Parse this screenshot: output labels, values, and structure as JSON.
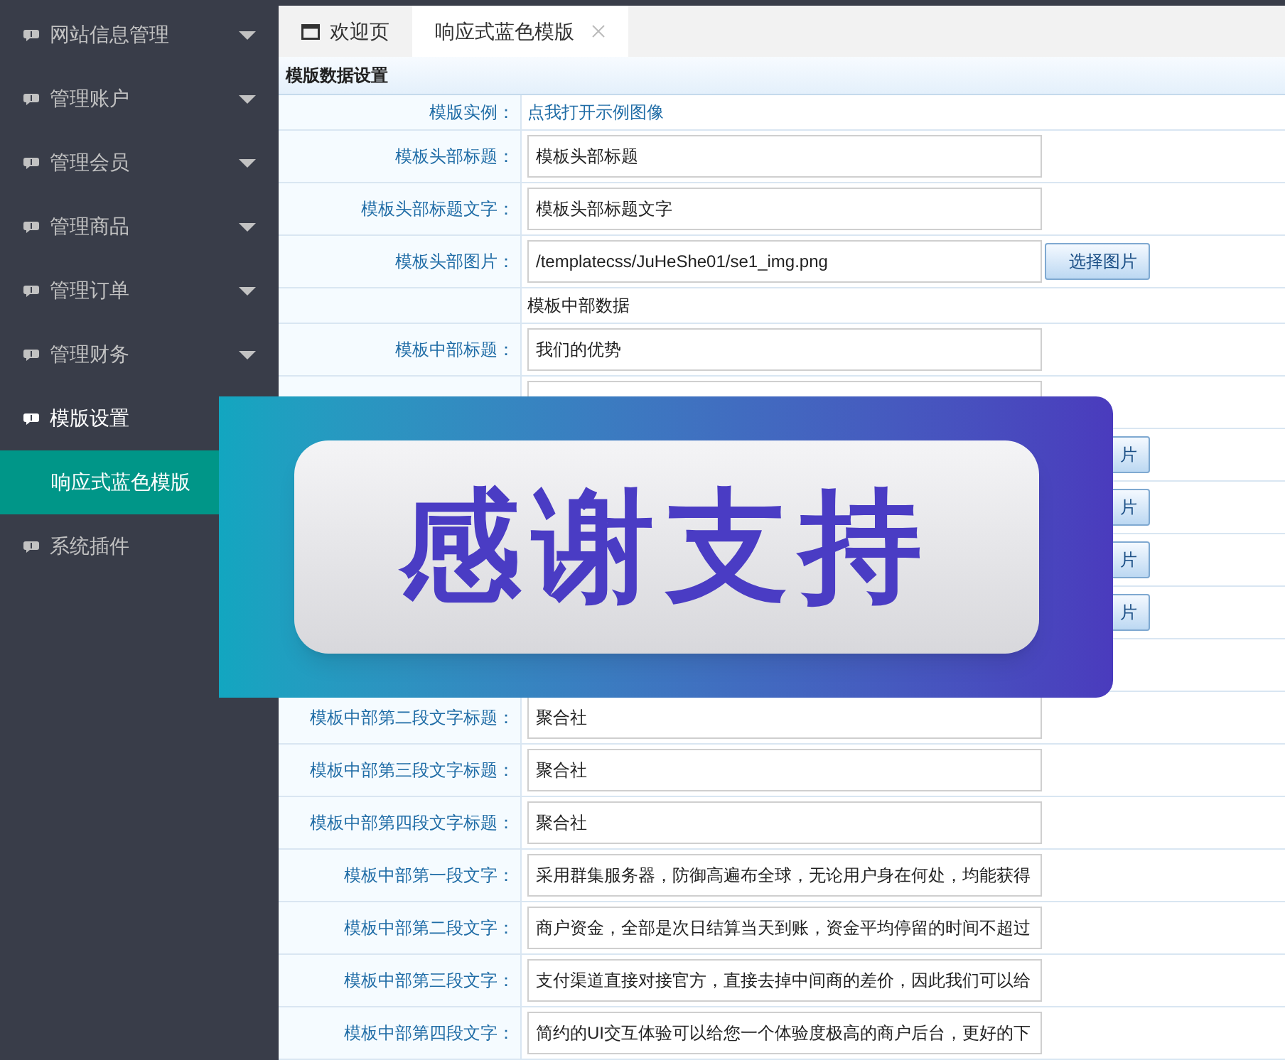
{
  "sidebar": {
    "items": [
      {
        "label": "网站信息管理",
        "expanded": false
      },
      {
        "label": "管理账户",
        "expanded": false
      },
      {
        "label": "管理会员",
        "expanded": false
      },
      {
        "label": "管理商品",
        "expanded": false
      },
      {
        "label": "管理订单",
        "expanded": false
      },
      {
        "label": "管理财务",
        "expanded": false
      },
      {
        "label": "模版设置",
        "expanded": true,
        "children": [
          {
            "label": "响应式蓝色模版",
            "selected": true
          }
        ]
      },
      {
        "label": "系统插件"
      }
    ]
  },
  "tabs": [
    {
      "label": "欢迎页",
      "kind": "home",
      "selected": false
    },
    {
      "label": "响应式蓝色模版",
      "kind": "closable",
      "selected": true
    }
  ],
  "form": {
    "title": "模版数据设置",
    "rows": [
      {
        "kind": "link",
        "label": "模版实例：",
        "value": "点我打开示例图像"
      },
      {
        "kind": "input",
        "label": "模板头部标题：",
        "value": "模板头部标题"
      },
      {
        "kind": "input",
        "label": "模板头部标题文字：",
        "value": "模板头部标题文字"
      },
      {
        "kind": "image",
        "label": "模板头部图片：",
        "value": "/templatecss/JuHeShe01/se1_img.png",
        "button": "选择图片"
      },
      {
        "kind": "text",
        "value": "模板中部数据"
      },
      {
        "kind": "input",
        "label": "模板中部标题：",
        "value": "我们的优势"
      },
      {
        "kind": "input"
      },
      {
        "kind": "image",
        "button": "片"
      },
      {
        "kind": "image",
        "button": "片"
      },
      {
        "kind": "image",
        "button": "片"
      },
      {
        "kind": "image",
        "button": "片"
      },
      {
        "kind": "text"
      },
      {
        "kind": "input",
        "label": "模板中部第二段文字标题：",
        "value": "聚合社"
      },
      {
        "kind": "input",
        "label": "模板中部第三段文字标题：",
        "value": "聚合社"
      },
      {
        "kind": "input",
        "label": "模板中部第四段文字标题：",
        "value": "聚合社"
      },
      {
        "kind": "input",
        "label": "模板中部第一段文字：",
        "value": "采用群集服务器，防御高遍布全球，无论用户身在何处，均能获得"
      },
      {
        "kind": "input",
        "label": "模板中部第二段文字：",
        "value": "商户资金，全部是次日结算当天到账，资金平均停留的时间不超过"
      },
      {
        "kind": "input",
        "label": "模板中部第三段文字：",
        "value": "支付渠道直接对接官方，直接去掉中间商的差价，因此我们可以给"
      },
      {
        "kind": "input",
        "label": "模板中部第四段文字：",
        "value": "简约的UI交互体验可以给您一个体验度极高的商户后台，更好的下"
      }
    ]
  },
  "overlay_banner": {
    "text": "感谢支持"
  }
}
